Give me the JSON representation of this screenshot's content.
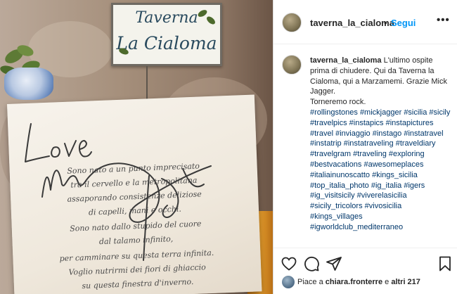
{
  "sign": {
    "line1": "Taverna",
    "line2": "La Cialoma"
  },
  "poem": {
    "lines": [
      "Sono nato a un punto imprecisato",
      "tra il cervello e la metropolitana",
      "assaporando consistenze deliziose",
      "di capelli, mani e occhi.",
      "Sono nato dallo stupido del cuore",
      "dal talamo infinito,",
      "per camminare su questa terra infinita.",
      "Voglio nutrirmi dei fiori di ghiaccio",
      "su questa finestra d'inverno."
    ],
    "handwriting": "Love"
  },
  "header": {
    "username": "taverna_la_cialoma",
    "separator": "•",
    "follow_label": "Segui",
    "more_icon": "more-horizontal-icon"
  },
  "caption": {
    "username": "taverna_la_cialoma",
    "text": "L'ultimo ospite prima di chiudere. Qui da Taverna la Cialoma, qui a Marzamemi. Grazie Mick Jagger.",
    "line2": "Torneremo rock.",
    "hashtags": [
      "#rollingstones",
      "#mickjagger",
      "#sicilia",
      "#sicily",
      "#travelpics",
      "#instapics",
      "#instapictures",
      "#travel",
      "#inviaggio",
      "#instago",
      "#instatravel",
      "#instatrip",
      "#instatraveling",
      "#traveldiary",
      "#travelgram",
      "#traveling",
      "#exploring",
      "#bestvacations",
      "#awesomeplaces",
      "#italiainunoscatto",
      "#kings_sicilia",
      "#top_italia_photo",
      "#ig_italia",
      "#igers",
      "#ig_visitsicily",
      "#viverelasicilia",
      "#sicily_tricolors",
      "#vivosicilia",
      "#kings_villages",
      "#igworldclub_mediterraneo"
    ]
  },
  "actions": {
    "icons": [
      "heart-icon",
      "comment-icon",
      "share-icon",
      "bookmark-icon"
    ],
    "likes_prefix": "Piace a",
    "likes_user": "chiara.fronterre",
    "likes_and": "e",
    "likes_others": "altri 217"
  }
}
